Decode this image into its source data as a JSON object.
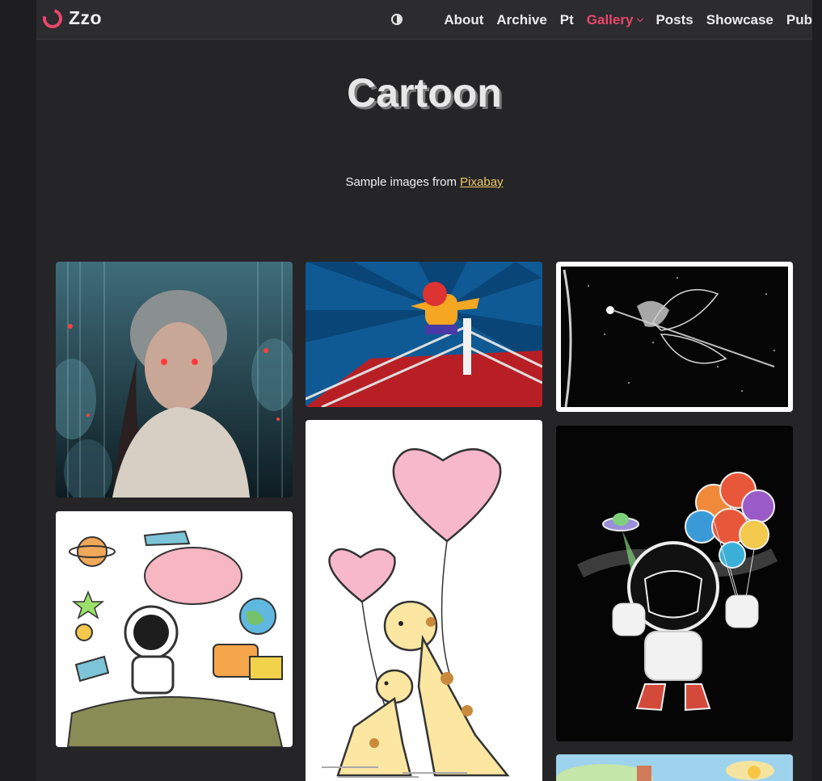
{
  "header": {
    "logo_text": "Zzo",
    "theme_toggle_icon": "contrast-icon",
    "nav": [
      "About",
      "Archive",
      "Pt",
      "Gallery",
      "Posts",
      "Showcase",
      "Pub"
    ],
    "active_nav": "Gallery"
  },
  "main": {
    "title": "Cartoon",
    "subtitle_prefix": "Sample images from ",
    "subtitle_link": "Pixabay"
  },
  "gallery": {
    "images": [
      "rainy-woman-illustration",
      "wrestler-jumping-ring",
      "fairy-on-dragonfly-sketch",
      "astronaut-space-doodle",
      "giraffes-heart-balloons",
      "astronaut-planet-balloons",
      "watercolor-landscape"
    ]
  },
  "colors": {
    "accent": "#e8476c",
    "link": "#f3c969",
    "background": "#252527"
  }
}
